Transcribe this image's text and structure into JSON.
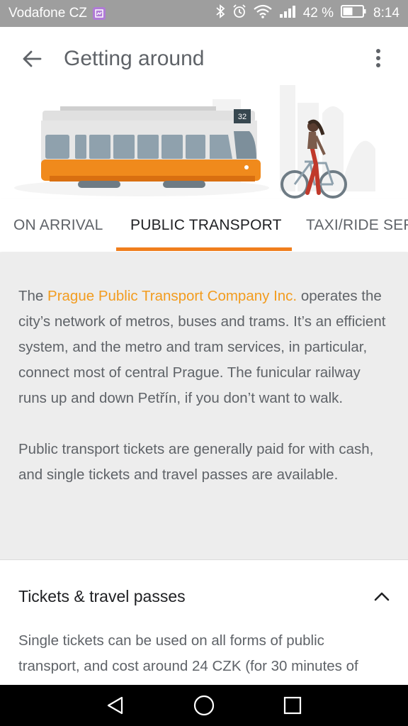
{
  "status_bar": {
    "carrier": "Vodafone CZ",
    "battery_percent": "42 %",
    "time": "8:14",
    "icons": [
      "sim-icon",
      "bluetooth-icon",
      "alarm-icon",
      "wifi-icon",
      "signal-icon",
      "battery-icon"
    ]
  },
  "app_bar": {
    "title": "Getting around",
    "back_icon": "arrow-back-icon",
    "more_icon": "more-vert-icon"
  },
  "hero": {
    "tram_number": "32"
  },
  "tabs": [
    {
      "label": "ON ARRIVAL",
      "active": false
    },
    {
      "label": "PUBLIC TRANSPORT",
      "active": true
    },
    {
      "label": "TAXI/RIDE SER",
      "active": false
    }
  ],
  "intro": {
    "p1_prefix": "The ",
    "p1_link": "Prague Public Transport Company Inc.",
    "p1_rest": " operates the city’s network of metros, buses and trams. It’s an efficient system, and the metro and tram services, in particular, connect most of central Prague. The funicular railway runs up and down Petřín, if you don’t want to walk.",
    "p2": "Public transport tickets are generally paid for with cash, and single tickets and travel passes are available."
  },
  "section": {
    "title": "Tickets & travel passes",
    "body": "Single tickets can be used on all forms of public transport, and cost around 24 CZK (for 30 minutes of"
  },
  "colors": {
    "accent": "#f07e1c",
    "link": "#f29c1f",
    "status_bar": "#9e9e9e"
  }
}
